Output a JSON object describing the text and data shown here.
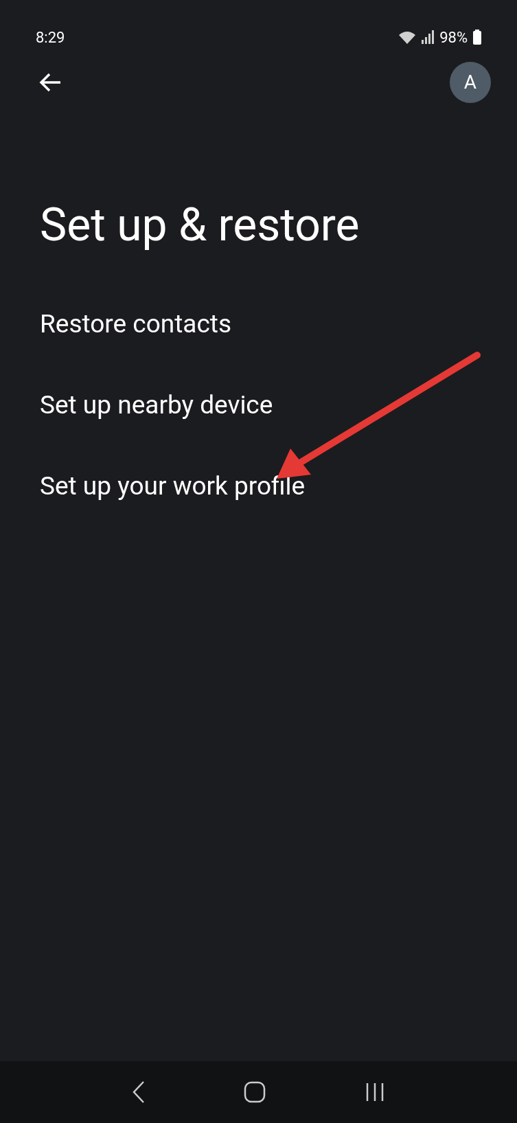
{
  "status_bar": {
    "time": "8:29",
    "battery": "98%"
  },
  "header": {
    "avatar": "A"
  },
  "title": "Set up & restore",
  "items": [
    {
      "label": "Restore contacts"
    },
    {
      "label": "Set up nearby device"
    },
    {
      "label": "Set up your work profile"
    }
  ]
}
